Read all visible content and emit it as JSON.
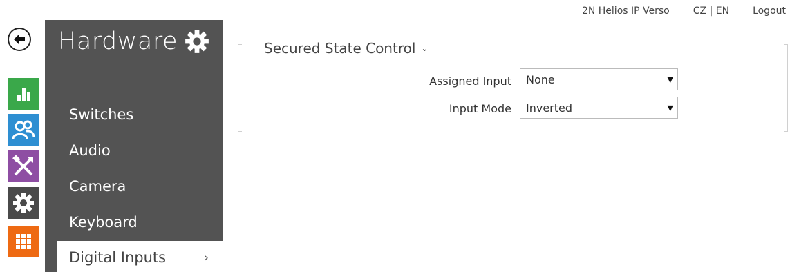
{
  "topbar": {
    "device_name": "2N Helios IP Verso",
    "language": "CZ | EN",
    "logout": "Logout"
  },
  "rail": {
    "icons": [
      "back-icon",
      "status-chart-icon",
      "directory-users-icon",
      "services-tools-icon",
      "hardware-gear-icon",
      "system-grid-icon"
    ],
    "colors": {
      "status": "#3aa84a",
      "directory": "#2e8fd2",
      "services": "#8e4ea3",
      "hardware": "#4a4a4a",
      "system": "#ee6a13"
    }
  },
  "sidebar": {
    "title": "Hardware",
    "items": [
      {
        "label": "Switches"
      },
      {
        "label": "Audio"
      },
      {
        "label": "Camera"
      },
      {
        "label": "Keyboard"
      },
      {
        "label": "Digital Inputs",
        "active": true
      }
    ],
    "background": "#535353"
  },
  "section": {
    "title": "Secured State Control",
    "fields": [
      {
        "label": "Assigned Input",
        "value": "None"
      },
      {
        "label": "Input Mode",
        "value": "Inverted"
      }
    ]
  }
}
